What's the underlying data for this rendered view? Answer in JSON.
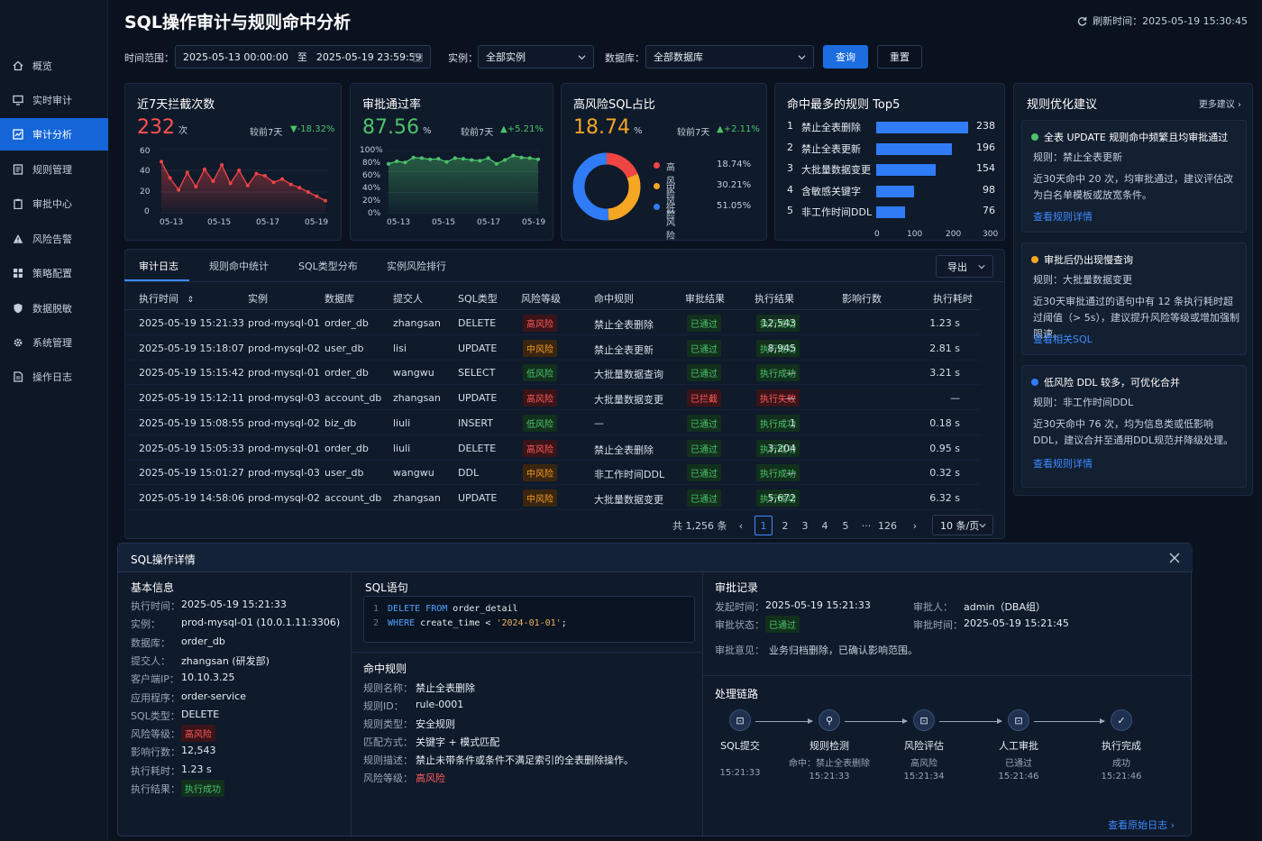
{
  "app": {
    "title": "SQL操作审计与规则命中分析",
    "refresh": "刷新时间：2025-05-19 15:30:45"
  },
  "sidebar": {
    "items": [
      {
        "label": "概览"
      },
      {
        "label": "实时审计"
      },
      {
        "label": "审计分析",
        "active": true
      },
      {
        "label": "规则管理"
      },
      {
        "label": "审批中心"
      },
      {
        "label": "风险告警"
      },
      {
        "label": "策略配置"
      },
      {
        "label": "数据脱敏"
      },
      {
        "label": "系统管理"
      },
      {
        "label": "操作日志"
      }
    ]
  },
  "filters": {
    "time_label": "时间范围：",
    "start": "2025-05-13 00:00:00",
    "to": "至",
    "end": "2025-05-19 23:59:59",
    "instance_label": "实例：",
    "instance": "全部实例",
    "db_label": "数据库：",
    "db": "全部数据库",
    "query": "查询",
    "reset": "重置"
  },
  "stats": {
    "blocked": {
      "title": "近7天拦截次数",
      "value": "232",
      "unit": "次",
      "cmp": "较前7天",
      "delta": "▼-18.32%",
      "y_ticks": [
        "60",
        "40",
        "20",
        "0"
      ],
      "x_ticks": [
        "05-13",
        "05-15",
        "05-17",
        "05-19"
      ]
    },
    "approval": {
      "title": "审批通过率",
      "value": "87.56",
      "unit": "%",
      "cmp": "较前7天",
      "delta": "▲+5.21%",
      "y_ticks": [
        "100%",
        "80%",
        "60%",
        "40%",
        "20%",
        "0%"
      ],
      "x_ticks": [
        "05-13",
        "05-15",
        "05-17",
        "05-19"
      ]
    },
    "highrisk": {
      "title": "高风险SQL占比",
      "value": "18.74",
      "unit": "%",
      "cmp": "较前7天",
      "delta": "▲+2.11%",
      "legend": [
        {
          "name": "高风险",
          "value": "18.74%",
          "color": "#ef4444"
        },
        {
          "name": "中风险",
          "value": "30.21%",
          "color": "#f5a623"
        },
        {
          "name": "低风险",
          "value": "51.05%",
          "color": "#2f7cf6"
        }
      ]
    },
    "top5": {
      "title": "命中最多的规则 Top5",
      "x_ticks": [
        "0",
        "100",
        "200",
        "300"
      ],
      "rules": [
        {
          "rank": "1",
          "name": "禁止全表删除",
          "value": "238"
        },
        {
          "rank": "2",
          "name": "禁止全表更新",
          "value": "196"
        },
        {
          "rank": "3",
          "name": "大批量数据变更",
          "value": "154"
        },
        {
          "rank": "4",
          "name": "含敏感关键字",
          "value": "98"
        },
        {
          "rank": "5",
          "name": "非工作时间DDL",
          "value": "76"
        }
      ]
    }
  },
  "chart_data": [
    {
      "type": "area",
      "title": "近7天拦截次数",
      "ylim": [
        0,
        60
      ],
      "x": [
        "05-13",
        "",
        "05-15",
        "",
        "05-17",
        "",
        "05-19"
      ],
      "values": [
        48,
        33,
        22,
        38,
        25,
        41,
        30,
        45,
        28,
        40,
        26,
        37,
        35,
        29,
        32,
        27,
        24,
        20,
        16,
        12
      ]
    },
    {
      "type": "area",
      "title": "审批通过率",
      "ylim": [
        0,
        100
      ],
      "values": [
        79,
        83,
        81,
        89,
        88,
        86,
        87,
        82,
        88,
        87,
        85,
        84,
        88,
        79,
        85,
        92,
        89,
        88,
        86
      ]
    },
    {
      "type": "pie",
      "title": "高风险SQL占比",
      "categories": [
        "高风险",
        "中风险",
        "低风险"
      ],
      "values": [
        18.74,
        30.21,
        51.05
      ]
    },
    {
      "type": "bar",
      "title": "命中最多的规则 Top5",
      "categories": [
        "禁止全表删除",
        "禁止全表更新",
        "大批量数据变更",
        "含敏感关键字",
        "非工作时间DDL"
      ],
      "values": [
        238,
        196,
        154,
        98,
        76
      ],
      "xlim": [
        0,
        300
      ]
    }
  ],
  "tabs": [
    "审计日志",
    "规则命中统计",
    "SQL类型分布",
    "实例风险排行"
  ],
  "export": "导出",
  "table": {
    "headers": [
      "执行时间",
      "实例",
      "数据库",
      "提交人",
      "SQL类型",
      "风险等级",
      "命中规则",
      "审批结果",
      "执行结果",
      "影响行数",
      "执行耗时"
    ],
    "rows": [
      [
        "2025-05-19 15:21:33",
        "prod-mysql-01",
        "order_db",
        "zhangsan",
        "DELETE",
        "高风险",
        "禁止全表删除",
        "已通过",
        "执行成功",
        "12,543",
        "1.23 s"
      ],
      [
        "2025-05-19 15:18:07",
        "prod-mysql-02",
        "user_db",
        "lisi",
        "UPDATE",
        "中风险",
        "禁止全表更新",
        "已通过",
        "执行成功",
        "8,945",
        "2.81 s"
      ],
      [
        "2025-05-19 15:15:42",
        "prod-mysql-01",
        "order_db",
        "wangwu",
        "SELECT",
        "低风险",
        "大批量数据查询",
        "已通过",
        "执行成功",
        "—",
        "3.21 s"
      ],
      [
        "2025-05-19 15:12:11",
        "prod-mysql-03",
        "account_db",
        "zhangsan",
        "UPDATE",
        "高风险",
        "大批量数据变更",
        "已拦截",
        "执行失败",
        "—",
        "—"
      ],
      [
        "2025-05-19 15:08:55",
        "prod-mysql-02",
        "biz_db",
        "liuli",
        "INSERT",
        "低风险",
        "—",
        "已通过",
        "执行成功",
        "1",
        "0.18 s"
      ],
      [
        "2025-05-19 15:05:33",
        "prod-mysql-01",
        "order_db",
        "liuli",
        "DELETE",
        "高风险",
        "禁止全表删除",
        "已通过",
        "执行成功",
        "3,204",
        "0.95 s"
      ],
      [
        "2025-05-19 15:01:27",
        "prod-mysql-03",
        "user_db",
        "wangwu",
        "DDL",
        "中风险",
        "非工作时间DDL",
        "已通过",
        "执行成功",
        "—",
        "0.32 s"
      ],
      [
        "2025-05-19 14:58:06",
        "prod-mysql-02",
        "account_db",
        "zhangsan",
        "UPDATE",
        "中风险",
        "大批量数据变更",
        "已通过",
        "执行成功",
        "5,672",
        "6.32 s"
      ]
    ]
  },
  "pagination": {
    "total": "共 1,256 条",
    "pages": [
      "1",
      "2",
      "3",
      "4",
      "5",
      "···",
      "126"
    ],
    "size": "10 条/页"
  },
  "suggestions": {
    "title": "规则优化建议",
    "more": "更多建议",
    "items": [
      {
        "title": "全表 UPDATE 规则命中频繁且均审批通过",
        "color": "#4cc36a",
        "rule": "规则：禁止全表更新",
        "desc": "近30天命中 20 次，均审批通过，建议评估改为白名单模板或放宽条件。",
        "link": "查看规则详情"
      },
      {
        "title": "审批后仍出现慢查询",
        "color": "#f5a623",
        "rule": "规则：大批量数据变更",
        "desc": "近30天审批通过的语句中有 12 条执行耗时超过阈值（> 5s），建议提升风险等级或增加强制限速。",
        "link": "查看相关SQL"
      },
      {
        "title": "低风险 DDL 较多，可优化合并",
        "color": "#2f7cf6",
        "rule": "规则：非工作时间DDL",
        "desc": "近30天命中 76 次，均为信息类或低影响DDL，建议合并至通用DDL规范并降级处理。",
        "link": "查看规则详情"
      }
    ]
  },
  "detail": {
    "title": "SQL操作详情",
    "basic_title": "基本信息",
    "basic": [
      {
        "k": "执行时间：",
        "v": "2025-05-19 15:21:33"
      },
      {
        "k": "实例：",
        "v": "prod-mysql-01 (10.0.1.11:3306)"
      },
      {
        "k": "数据库：",
        "v": "order_db"
      },
      {
        "k": "提交人：",
        "v": "zhangsan (研发部)"
      },
      {
        "k": "客户端IP：",
        "v": "10.10.3.25"
      },
      {
        "k": "应用程序：",
        "v": "order-service"
      },
      {
        "k": "SQL类型：",
        "v": "DELETE"
      },
      {
        "k": "风险等级：",
        "v": "高风险"
      },
      {
        "k": "影响行数：",
        "v": "12,543"
      },
      {
        "k": "执行耗时：",
        "v": "1.23 s"
      },
      {
        "k": "执行结果：",
        "v": "执行成功"
      }
    ],
    "sql_title": "SQL语句",
    "sql": {
      "l1n": "1",
      "l1a": "DELETE FROM",
      "l1b": " order_detail",
      "l2n": "2",
      "l2a": "WHERE",
      "l2b": " create_time < ",
      "l2c": "'2024-01-01'",
      "l2d": ";"
    },
    "rule_title": "命中规则",
    "rule": [
      {
        "k": "规则名称：",
        "v": "禁止全表删除"
      },
      {
        "k": "规则ID：",
        "v": "rule-0001"
      },
      {
        "k": "规则类型：",
        "v": "安全规则"
      },
      {
        "k": "匹配方式：",
        "v": "关键字 + 模式匹配"
      },
      {
        "k": "规则描述：",
        "v": "禁止未带条件或条件不满足索引的全表删除操作。"
      },
      {
        "k": "风险等级：",
        "v": "高风险"
      }
    ],
    "approval_title": "审批记录",
    "approval": {
      "submit_k": "发起时间：",
      "submit_v": "2025-05-19 15:21:33",
      "approver_k": "审批人：",
      "approver_v": "admin（DBA组）",
      "status_k": "审批状态：",
      "status_v": "已通过",
      "time_k": "审批时间：",
      "time_v": "2025-05-19 15:21:45",
      "opinion_k": "审批意见：",
      "opinion_v": "业务归档删除，已确认影响范围。"
    },
    "chain_title": "处理链路",
    "chain": [
      {
        "name": "SQL提交",
        "sub": "",
        "time": "15:21:33"
      },
      {
        "name": "规则检测",
        "sub": "命中：禁止全表删除",
        "time": "15:21:33"
      },
      {
        "name": "风险评估",
        "sub": "高风险",
        "time": "15:21:34"
      },
      {
        "name": "人工审批",
        "sub": "已通过",
        "time": "15:21:46"
      },
      {
        "name": "执行完成",
        "sub": "成功",
        "time": "15:21:46"
      }
    ],
    "raw_link": "查看原始日志"
  }
}
